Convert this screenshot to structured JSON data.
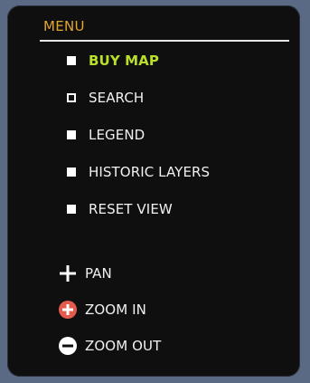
{
  "menu": {
    "title": "MENU",
    "items": [
      {
        "label": "BUY MAP",
        "bullet": "filled-square",
        "highlight": true
      },
      {
        "label": "SEARCH",
        "bullet": "outline-square",
        "highlight": false
      },
      {
        "label": "LEGEND",
        "bullet": "filled-square",
        "highlight": false
      },
      {
        "label": "HISTORIC LAYERS",
        "bullet": "filled-square",
        "highlight": false
      },
      {
        "label": "RESET VIEW",
        "bullet": "filled-square",
        "highlight": false
      }
    ]
  },
  "tools": [
    {
      "label": "PAN",
      "icon": "pan-cross-icon"
    },
    {
      "label": "ZOOM IN",
      "icon": "zoom-in-plus-icon"
    },
    {
      "label": "ZOOM OUT",
      "icon": "zoom-out-minus-icon"
    }
  ],
  "colors": {
    "background": "#5a6a84",
    "panel": "#0f0f10",
    "title": "#e4a62c",
    "highlight": "#b9df2a",
    "text": "#f1f1f1",
    "zoom_in": "#e35b4c",
    "zoom_out": "#ffffff"
  }
}
